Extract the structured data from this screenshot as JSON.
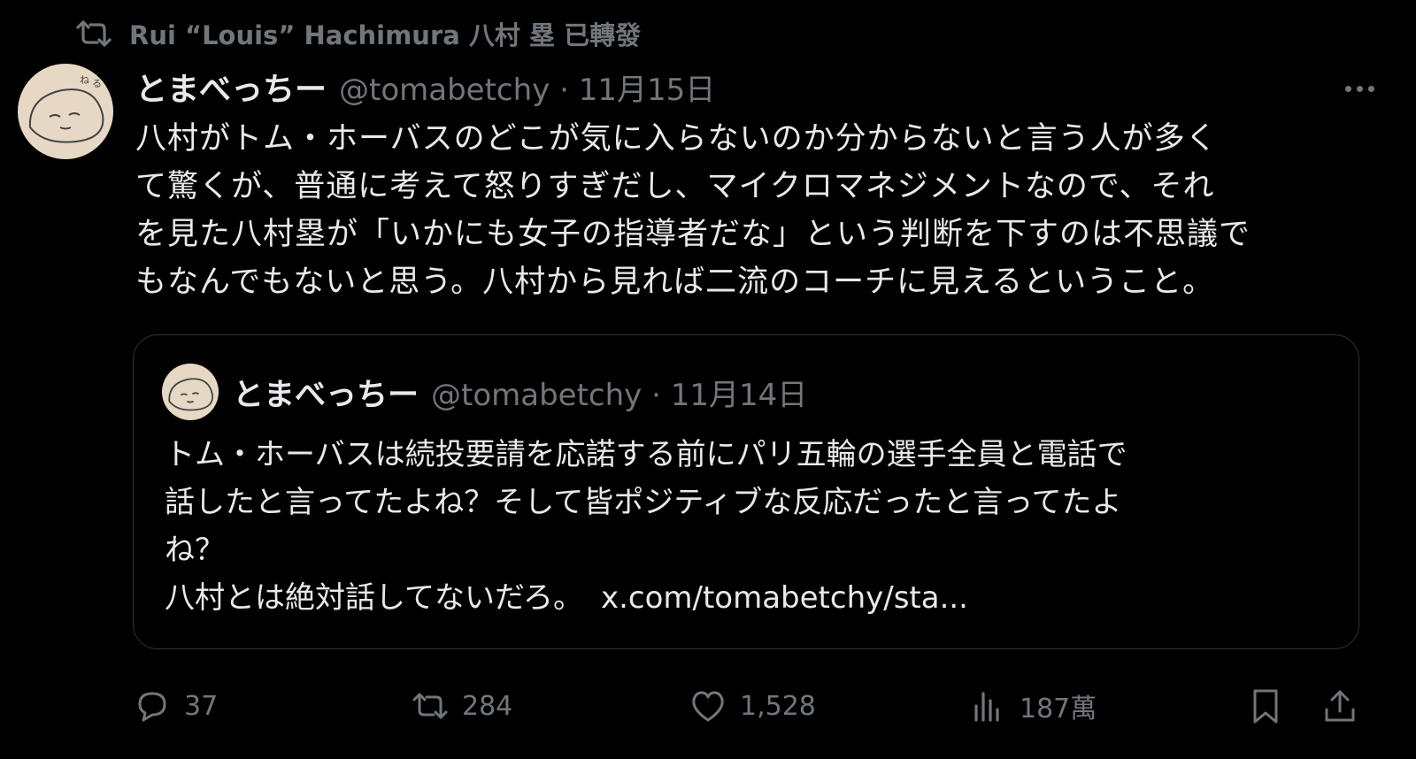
{
  "repost": {
    "icon": "repost-icon",
    "text": "Rui “Louis” Hachimura 八村 塁 已轉發"
  },
  "tweet": {
    "avatar": "avatar",
    "display_name": "とまべっちー",
    "handle_date": "@tomabetchy · 11月15日",
    "more": "more-icon",
    "lines": [
      "八村がトム・ホーバスのどこが気に入らないのか分からないと言う人が多く",
      "て驚くが、普通に考えて怒りすぎだし、マイクロマネジメントなので、それ",
      "を見た八村塁が「いかにも女子の指導者だな」という判断を下すのは不思議で",
      "もなんでもないと思う。八村から見れば二流のコーチに見えるということ。"
    ]
  },
  "quote": {
    "display_name": "とまべっちー",
    "handle_date": "@tomabetchy · 11月14日",
    "lines": [
      "トム・ホーバスは続投要請を応諾する前にパリ五輪の選手全員と電話で",
      "話したと言ってたよね？そして皆ポジティブな反応だったと言ってたよ",
      "ね？"
    ],
    "last_line_text": "八村とは絶対話してないだろ。",
    "link": "x.com/tomabetchy/sta..."
  },
  "actions": {
    "reply_count": "37",
    "repost_count": "284",
    "like_count": "1,528",
    "views_count": "187萬"
  },
  "colors": {
    "background": "#000000",
    "text": "#e7e9ea",
    "muted": "#71767b",
    "border": "#2f3336"
  }
}
